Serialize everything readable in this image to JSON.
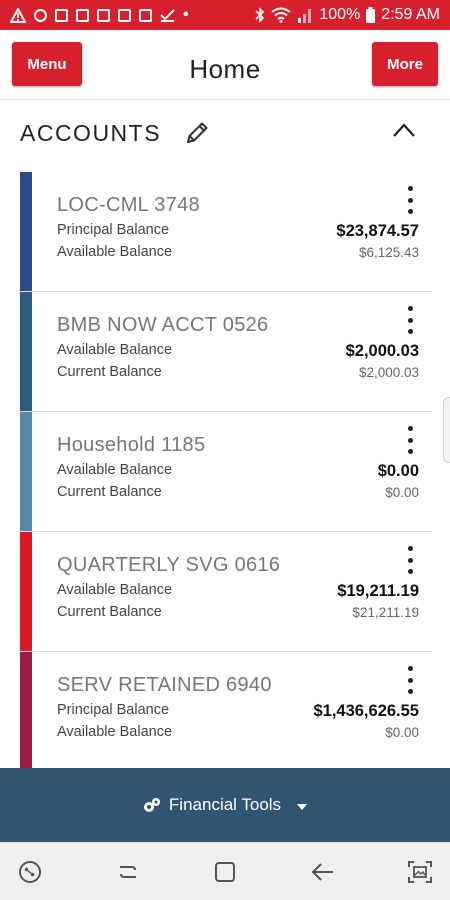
{
  "status_bar": {
    "battery": "100%",
    "time": "2:59 AM",
    "bg_color": "#d6202e"
  },
  "header": {
    "menu_label": "Menu",
    "title": "Home",
    "more_label": "More",
    "brand_color": "#d6202e"
  },
  "accounts": {
    "title": "ACCOUNTS",
    "items": [
      {
        "name": "LOC-CML 3748",
        "label1": "Principal Balance",
        "amount1": "$23,874.57",
        "label2": "Available Balance",
        "amount2": "$6,125.43",
        "color": "#2e4a8b"
      },
      {
        "name": "BMB NOW ACCT 0526",
        "label1": "Available Balance",
        "amount1": "$2,000.03",
        "label2": "Current Balance",
        "amount2": "$2,000.03",
        "color": "#2d5d7b"
      },
      {
        "name": "Household 1185",
        "label1": "Available Balance",
        "amount1": "$0.00",
        "label2": "Current Balance",
        "amount2": "$0.00",
        "color": "#5c88a8"
      },
      {
        "name": "QUARTERLY SVG 0616",
        "label1": "Available Balance",
        "amount1": "$19,211.19",
        "label2": "Current Balance",
        "amount2": "$21,211.19",
        "color": "#d9182a"
      },
      {
        "name": "SERV RETAINED 6940",
        "label1": "Principal Balance",
        "amount1": "$1,436,626.55",
        "label2": "Available Balance",
        "amount2": "$0.00",
        "color": "#9b1d4a"
      }
    ]
  },
  "footer": {
    "financial_tools_label": "Financial Tools",
    "bg_color": "#2f5572"
  },
  "icons": {
    "edit": "pencil-icon",
    "collapse": "chevron-up-icon",
    "account_menu": "kebab-menu-icon",
    "tools": "tools-icon",
    "dropdown": "caret-down-icon",
    "nav": [
      "assistant-icon",
      "recents-icon",
      "home-icon",
      "back-icon",
      "screenshot-icon"
    ]
  }
}
